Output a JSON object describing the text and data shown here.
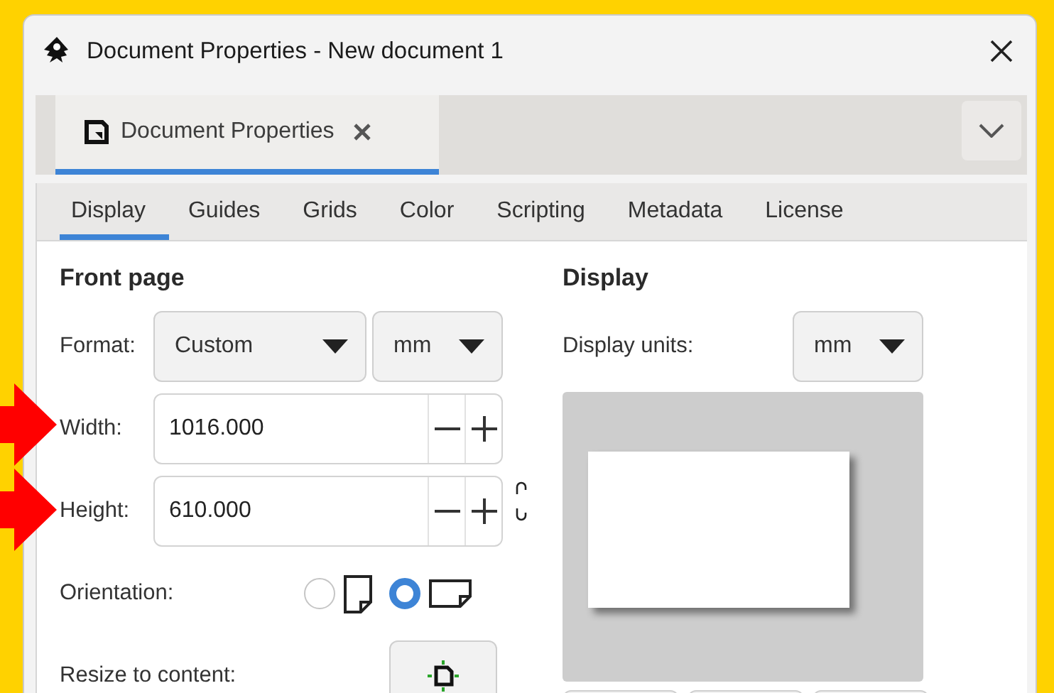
{
  "window": {
    "title": "Document Properties - New document 1"
  },
  "dock_tab": {
    "label": "Document Properties",
    "selected": true
  },
  "tabs": [
    {
      "label": "Display",
      "selected": true
    },
    {
      "label": "Guides",
      "selected": false
    },
    {
      "label": "Grids",
      "selected": false
    },
    {
      "label": "Color",
      "selected": false
    },
    {
      "label": "Scripting",
      "selected": false
    },
    {
      "label": "Metadata",
      "selected": false
    },
    {
      "label": "License",
      "selected": false
    }
  ],
  "front_page": {
    "title": "Front page",
    "format_label": "Format:",
    "format_value": "Custom",
    "unit_value": "mm",
    "width_label": "Width:",
    "width_value": "1016.000",
    "height_label": "Height:",
    "height_value": "610.000",
    "orientation_label": "Orientation:",
    "orientations": [
      {
        "kind": "portrait",
        "selected": false
      },
      {
        "kind": "landscape",
        "selected": true
      }
    ],
    "resize_label": "Resize to content:"
  },
  "display": {
    "title": "Display",
    "units_label": "Display units:",
    "units_value": "mm"
  },
  "annotations": [
    {
      "kind": "arrow"
    },
    {
      "kind": "arrow"
    }
  ]
}
